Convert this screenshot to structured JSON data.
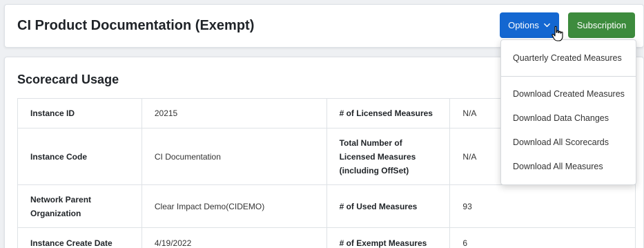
{
  "header": {
    "title": "CI Product Documentation (Exempt)",
    "options_label": "Options",
    "subscription_label": "Subscription"
  },
  "colors": {
    "primary": "#1467d1",
    "success": "#3d8b3d"
  },
  "scorecard_usage": {
    "title": "Scorecard Usage",
    "rows": [
      {
        "label1": "Instance ID",
        "value1": "20215",
        "label2": "# of Licensed Measures",
        "value2": "N/A"
      },
      {
        "label1": "Instance Code",
        "value1": "CI Documentation",
        "label2": "Total Number of Licensed Measures (including OffSet)",
        "value2": "N/A"
      },
      {
        "label1": "Network Parent Organization",
        "value1": "Clear Impact Demo(CIDEMO)",
        "label2": "# of Used Measures",
        "value2": "93"
      },
      {
        "label1": "Instance Create Date",
        "value1": "4/19/2022",
        "label2": "# of Exempt Measures",
        "value2": "6"
      }
    ]
  },
  "options_menu": {
    "items": [
      "Quarterly Created Measures",
      "Download Created Measures",
      "Download Data Changes",
      "Download All Scorecards",
      "Download All Measures"
    ]
  }
}
